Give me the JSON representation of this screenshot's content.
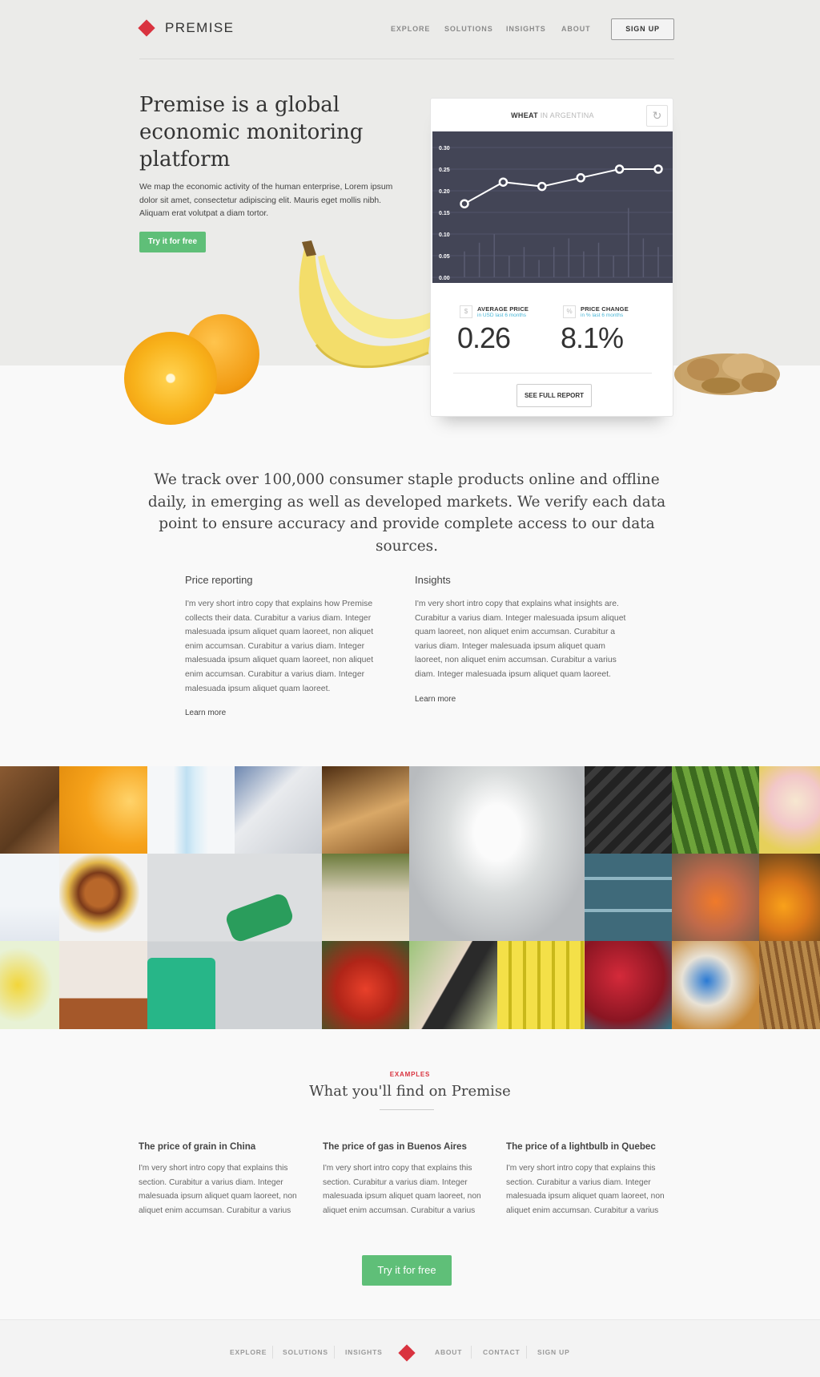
{
  "brand": {
    "name": "PREMISE",
    "accent": "#d9333f",
    "green": "#5fbf78"
  },
  "nav": {
    "explore": "EXPLORE",
    "solutions": "SOLUTIONS",
    "insights": "INSIGHTS",
    "about": "ABOUT",
    "signup": "SIGN UP"
  },
  "hero": {
    "title": "Premise is a global economic monitoring platform",
    "description": "We map the economic activity of the human enterprise, Lorem ipsum dolor sit amet, consectetur adipiscing elit. Mauris eget mollis nibh. Aliquam erat volutpat a diam tortor.",
    "cta": "Try it for free"
  },
  "card": {
    "commodity": "WHEAT",
    "location": "IN ARGENTINA",
    "refresh_icon": "refresh-icon",
    "average_price": {
      "icon": "$",
      "label": "AVERAGE PRICE",
      "sub": "in USD last 6 months",
      "value": "0.26"
    },
    "price_change": {
      "icon": "%",
      "label": "PRICE CHANGE",
      "sub": "in % last 6 months",
      "value": "8.1%"
    },
    "report_button": "SEE FULL REPORT"
  },
  "chart_data": {
    "type": "line",
    "title": "",
    "xlabel": "",
    "ylabel": "",
    "ylim": [
      0,
      0.3
    ],
    "y_ticks": [
      "0.30",
      "0.25",
      "0.20",
      "0.15",
      "0.10",
      "0.05",
      "0.00"
    ],
    "values": [
      0.17,
      0.22,
      0.21,
      0.23,
      0.25,
      0.25
    ],
    "volume_bars": [
      0.06,
      0.08,
      0.1,
      0.05,
      0.07,
      0.04,
      0.07,
      0.09,
      0.06,
      0.08,
      0.05,
      0.16,
      0.09,
      0.07
    ],
    "grid": true,
    "background": "#434556",
    "line_color": "#ffffff"
  },
  "tagline": "We track over 100,000 consumer staple products online and offline daily, in emerging as well as developed markets. We verify each data point to ensure accuracy and provide complete access to our data sources.",
  "features": [
    {
      "title": "Price reporting",
      "body": "I'm very short intro copy that explains how Premise collects their data. Curabitur a varius diam. Integer malesuada ipsum aliquet quam laoreet, non aliquet enim accumsan.  Curabitur a varius diam. Integer malesuada ipsum aliquet quam laoreet, non aliquet enim accumsan. Curabitur a varius diam. Integer malesuada ipsum aliquet quam laoreet.",
      "link": "Learn more"
    },
    {
      "title": "Insights",
      "body": "I'm very short intro copy that explains what insights are. Curabitur a varius diam. Integer malesuada ipsum aliquet quam laoreet, non aliquet enim accumsan. Curabitur a varius diam. Integer malesuada ipsum aliquet quam laoreet, non aliquet enim accumsan. Curabitur a varius diam. Integer malesuada ipsum aliquet quam laoreet.",
      "link": "Learn more"
    }
  ],
  "mosaic": [
    "bread",
    "orange",
    "water-bottle",
    "stove",
    "pasta",
    "lightbulb",
    "tire",
    "asparagus",
    "cupcake",
    "yogurt",
    "burger",
    "fuel-pump",
    "grocery-bag",
    "pills",
    "carrots",
    "market-fruit",
    "bananas",
    "pillows",
    "tomatoes",
    "phone",
    "bottles",
    "berries",
    "cleaning-supplies",
    "grain"
  ],
  "examples": {
    "kicker": "EXAMPLES",
    "title": "What you'll find on Premise",
    "items": [
      {
        "title": "The price of grain in China",
        "body": "I'm very short intro copy that explains this section. Curabitur a varius diam. Integer malesuada ipsum aliquet quam laoreet, non aliquet enim accumsan.  Curabitur a varius"
      },
      {
        "title": "The price of gas in Buenos Aires",
        "body": "I'm very short intro copy that explains this section. Curabitur a varius diam. Integer malesuada ipsum aliquet quam laoreet, non aliquet enim accumsan.  Curabitur a varius"
      },
      {
        "title": "The price of a lightbulb in Quebec",
        "body": "I'm very short intro copy that explains this section. Curabitur a varius diam. Integer malesuada ipsum aliquet quam laoreet, non aliquet enim accumsan.  Curabitur a varius"
      }
    ],
    "cta": "Try it for free"
  },
  "footer": {
    "explore": "EXPLORE",
    "solutions": "SOLUTIONS",
    "insights": "INSIGHTS",
    "about": "ABOUT",
    "contact": "CONTACT",
    "signup": "SIGN UP"
  }
}
